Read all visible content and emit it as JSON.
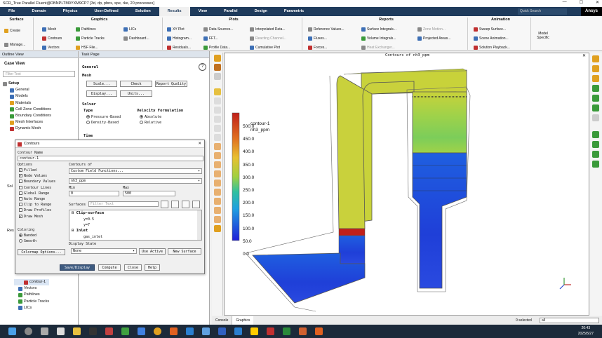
{
  "window": {
    "title": "SCR_True Parallel Fluent@DBNPLTM0YXM9CP7 [3d, dp, pbns, spe, rke, 20 processes]",
    "controls": [
      "—",
      "☐",
      "✕"
    ]
  },
  "menu": {
    "tabs": [
      "File",
      "Domain",
      "Physics",
      "User-Defined",
      "Solution",
      "Results",
      "View",
      "Parallel",
      "Design",
      "Parametric"
    ],
    "active": "Results",
    "search_placeholder": "Quick Search",
    "brand": "Ansys"
  },
  "ribbon": {
    "surface": {
      "title": "Surface",
      "create": "Create",
      "manage": "Manage..."
    },
    "graphics": {
      "title": "Graphics",
      "items": [
        "Mesh",
        "Contours",
        "Vectors",
        "Pathlines",
        "Particle Tracks",
        "HSF File...",
        "LICs",
        "Dashboard..."
      ]
    },
    "plots": {
      "title": "Plots",
      "items": [
        "XY Plot",
        "Histogram...",
        "Residuals...",
        "Data Sources...",
        "FFT...",
        "Profile Data...",
        "Interpolated Data...",
        "Reacting Channel...",
        "Cumulative Plot"
      ]
    },
    "reports": {
      "title": "Reports",
      "items": [
        "Reference Values...",
        "Fluxes...",
        "Forces...",
        "Surface Integrals...",
        "Volume Integrals...",
        "Heat Exchanger...",
        "Zone Motion...",
        "Projected Areas..."
      ]
    },
    "animation": {
      "title": "Animation",
      "items": [
        "Sweep Surface...",
        "Scene Animation...",
        "Solution Playback..."
      ]
    },
    "model_specific": "Model Specific"
  },
  "outline": {
    "title": "Outline View",
    "case_view": "Case View",
    "filter_placeholder": "Filter Text",
    "items": [
      "Setup",
      "General",
      "Models",
      "Materials",
      "Cell Zone Conditions",
      "Boundary Conditions",
      "Mesh Interfaces",
      "Dynamic Mesh"
    ],
    "lower_items": [
      "contour-1",
      "Vectors",
      "Pathlines",
      "Particle Tracks",
      "LICs"
    ],
    "side_letters": [
      "Sol",
      "Res"
    ]
  },
  "task_page": {
    "title": "Task Page",
    "section": "General",
    "mesh_label": "Mesh",
    "buttons": [
      "Scale...",
      "Check",
      "Report Quality",
      "Display...",
      "Units..."
    ],
    "solver_label": "Solver",
    "type_label": "Type",
    "type_options": [
      "Pressure-Based",
      "Density-Based"
    ],
    "velocity_label": "Velocity Formulation",
    "velocity_options": [
      "Absolute",
      "Relative"
    ],
    "time_label": "Time"
  },
  "dialog": {
    "title": "Contours",
    "name_label": "Contour Name",
    "name_value": "contour-1",
    "options_label": "Options",
    "options": [
      {
        "label": "Filled",
        "checked": true
      },
      {
        "label": "Node Values",
        "checked": true
      },
      {
        "label": "Boundary Values",
        "checked": false
      },
      {
        "label": "Contour Lines",
        "checked": false
      },
      {
        "label": "Global Range",
        "checked": false
      },
      {
        "label": "Auto Range",
        "checked": false
      },
      {
        "label": "Clip to Range",
        "checked": false
      },
      {
        "label": "Draw Profiles",
        "checked": false
      },
      {
        "label": "Draw Mesh",
        "checked": true
      }
    ],
    "contours_of_label": "Contours of",
    "contours_of_value": "Custom Field Functions...",
    "variable_value": "nh3_ppm",
    "min_label": "Min",
    "max_label": "Max",
    "min_value": "0",
    "max_value": "500",
    "surfaces_label": "Surfaces",
    "surfaces_filter_placeholder": "Filter Text",
    "surfaces": [
      "Clip-surface",
      "y=0.5",
      "y=7",
      "Inlet",
      "gas_inlet"
    ],
    "coloring_label": "Coloring",
    "coloring_options": [
      "Banded",
      "Smooth"
    ],
    "colormap_button": "Colormap Options...",
    "display_state_label": "Display State",
    "display_state_value": "None",
    "use_active": "Use Active",
    "new_surface": "New Surface",
    "buttons": [
      "Save/Display",
      "Compute",
      "Close",
      "Help"
    ]
  },
  "graphics": {
    "title": "Contours of nh3_ppm",
    "legend_title": "contour-1",
    "legend_subtitle": "nh3_ppm",
    "legend_values": [
      "500.0",
      "450.0",
      "400.0",
      "350.0",
      "300.0",
      "250.0",
      "200.0",
      "150.0",
      "100.0",
      "50.0",
      "0.0"
    ],
    "colors": {
      "high": "#c0201a",
      "mid": "#c8d23a",
      "low": "#1f3fd8"
    }
  },
  "bottom": {
    "tabs": [
      "Console",
      "Graphics"
    ],
    "selected": "0 selected",
    "filter": "all"
  },
  "taskbar": {
    "time": "20:43",
    "date": "2025/5/27"
  }
}
